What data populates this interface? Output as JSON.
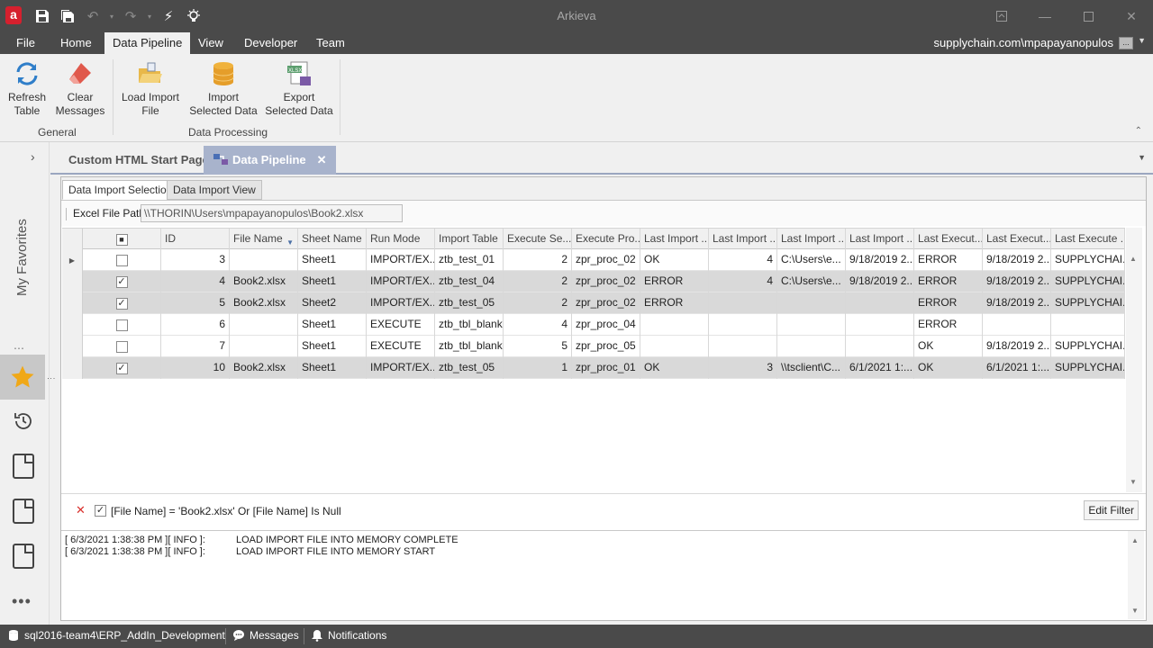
{
  "app": {
    "title": "Arkieva",
    "logo_letter": "a"
  },
  "ribbon_tabs": [
    "File",
    "Home",
    "Data Pipeline",
    "View",
    "Developer",
    "Team"
  ],
  "account": "supplychain.com\\mpapayanopulos",
  "ribbon": {
    "refresh_table": "Refresh Table",
    "clear_messages": "Clear Messages",
    "load_import_file": "Load Import File",
    "import_selected_data": "Import Selected Data",
    "export_selected_data": "Export Selected Data",
    "group_general": "General",
    "group_data_processing": "Data Processing"
  },
  "leftnav": {
    "favorites_label": "My Favorites"
  },
  "doc_tabs": {
    "start_page": "Custom HTML Start Page",
    "data_pipeline": "Data Pipeline"
  },
  "subtabs": {
    "selection": "Data Import Selection",
    "view": "Data Import View"
  },
  "path": {
    "label": "Excel File Path",
    "value": "\\\\THORIN\\Users\\mpapayanopulos\\Book2.xlsx"
  },
  "grid": {
    "columns": [
      "ID",
      "File Name",
      "Sheet Name",
      "Run Mode",
      "Import Table",
      "Execute Se...",
      "Execute Pro...",
      "Last Import ...",
      "Last Import ...",
      "Last Import ...",
      "Last Import ...",
      "Last Execut...",
      "Last Execut...",
      "Last Execute ..."
    ],
    "rows": [
      {
        "checked": false,
        "sel": false,
        "cells": [
          "3",
          "",
          "Sheet1",
          "IMPORT/EX...",
          "ztb_test_01",
          "2",
          "zpr_proc_02",
          "OK",
          "4",
          "C:\\Users\\e...",
          "9/18/2019 2...",
          "ERROR",
          "9/18/2019 2...",
          "SUPPLYCHAI..."
        ]
      },
      {
        "checked": true,
        "sel": true,
        "cells": [
          "4",
          "Book2.xlsx",
          "Sheet1",
          "IMPORT/EX...",
          "ztb_test_04",
          "2",
          "zpr_proc_02",
          "ERROR",
          "4",
          "C:\\Users\\e...",
          "9/18/2019 2...",
          "ERROR",
          "9/18/2019 2...",
          "SUPPLYCHAI..."
        ]
      },
      {
        "checked": true,
        "sel": true,
        "cells": [
          "5",
          "Book2.xlsx",
          "Sheet2",
          "IMPORT/EX...",
          "ztb_test_05",
          "2",
          "zpr_proc_02",
          "ERROR",
          "",
          "",
          "",
          "ERROR",
          "9/18/2019 2...",
          "SUPPLYCHAI..."
        ]
      },
      {
        "checked": false,
        "sel": false,
        "cells": [
          "6",
          "",
          "Sheet1",
          "EXECUTE",
          "ztb_tbl_blank",
          "4",
          "zpr_proc_04",
          "",
          "",
          "",
          "",
          "ERROR",
          "",
          ""
        ]
      },
      {
        "checked": false,
        "sel": false,
        "cells": [
          "7",
          "",
          "Sheet1",
          "EXECUTE",
          "ztb_tbl_blank",
          "5",
          "zpr_proc_05",
          "",
          "",
          "",
          "",
          "OK",
          "9/18/2019 2...",
          "SUPPLYCHAI..."
        ]
      },
      {
        "checked": true,
        "sel": true,
        "cells": [
          "10",
          "Book2.xlsx",
          "Sheet1",
          "IMPORT/EX...",
          "ztb_test_05",
          "1",
          "zpr_proc_01",
          "OK",
          "3",
          "\\\\tsclient\\C...",
          "6/1/2021 1:...",
          "OK",
          "6/1/2021 1:...",
          "SUPPLYCHAI..."
        ]
      }
    ]
  },
  "filter": {
    "text": "[File Name] = 'Book2.xlsx' Or [File Name] Is Null",
    "edit_label": "Edit Filter"
  },
  "messages": [
    {
      "ts": "[ 6/3/2021 1:38:38 PM ][ INFO ]:",
      "text": "LOAD IMPORT FILE INTO MEMORY COMPLETE"
    },
    {
      "ts": "[ 6/3/2021 1:38:38 PM ][ INFO ]:",
      "text": "LOAD IMPORT FILE INTO MEMORY START"
    }
  ],
  "status": {
    "connection": "sql2016-team4\\ERP_AddIn_Development",
    "messages": "Messages",
    "notifications": "Notifications"
  },
  "colors": {
    "titlebar": "#4a4a4a",
    "active_doc_tab": "#a8b3cc",
    "selected_row": "#d9d9d9",
    "logo": "#d6202e"
  }
}
